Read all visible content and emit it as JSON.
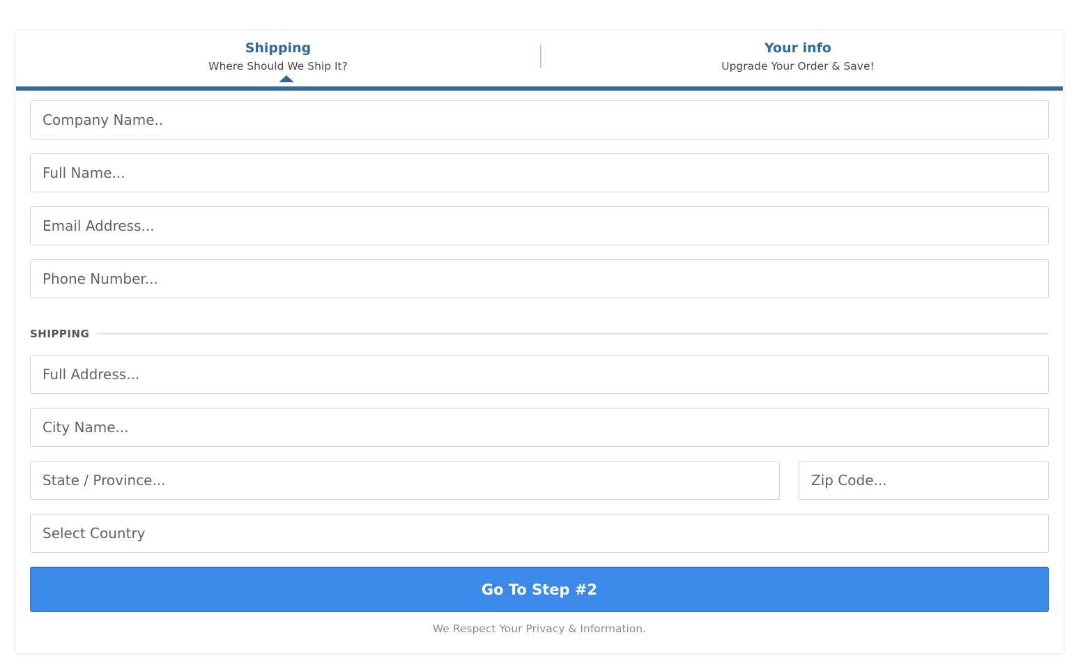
{
  "steps": [
    {
      "title": "Shipping",
      "subtitle": "Where Should We Ship It?",
      "active": true
    },
    {
      "title": "Your info",
      "subtitle": "Upgrade Your Order & Save!",
      "active": false
    }
  ],
  "form": {
    "company_placeholder": "Company Name..",
    "fullname_placeholder": "Full Name...",
    "email_placeholder": "Email Address...",
    "phone_placeholder": "Phone Number...",
    "section_label": "SHIPPING",
    "address_placeholder": "Full Address...",
    "city_placeholder": "City Name...",
    "state_placeholder": "State / Province...",
    "zip_placeholder": "Zip Code...",
    "country_select": "Select Country",
    "submit_label": "Go To Step #2",
    "privacy_note": "We Respect Your Privacy & Information."
  },
  "colors": {
    "step_accent": "#33699a",
    "step_title": "#2e6aa0",
    "button": "#3b8ae9"
  }
}
